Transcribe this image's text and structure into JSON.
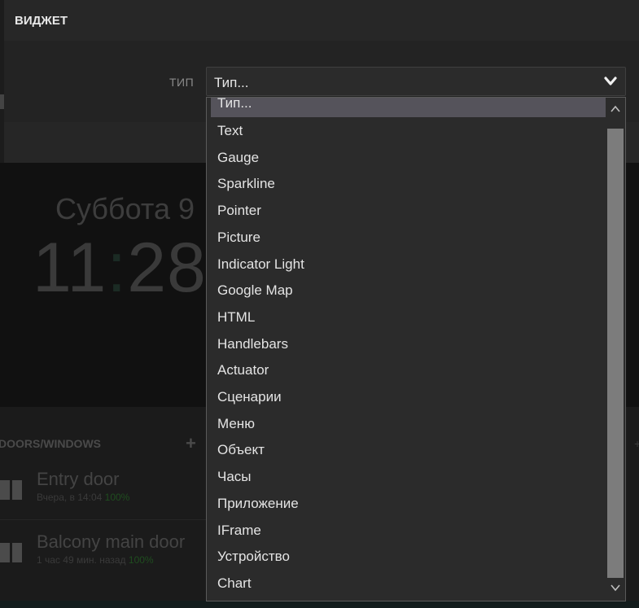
{
  "background": {
    "date": "Суббота 9",
    "time_h": "11",
    "time_colon": ":",
    "time_m": "28",
    "panel_title": "DOORS/WINDOWS",
    "add_symbol": "+",
    "right_edge_symbol": "+",
    "rows": [
      {
        "name": "Entry door",
        "meta": "Вчера, в 14:04",
        "pct": "100%"
      },
      {
        "name": "Balcony main door",
        "meta": "1 час 49 мин. назад",
        "pct": "100%"
      }
    ]
  },
  "modal": {
    "title": "ВИДЖЕТ",
    "field_label": "ТИП",
    "select_value": "Тип...",
    "options": [
      "Тип...",
      "Text",
      "Gauge",
      "Sparkline",
      "Pointer",
      "Picture",
      "Indicator Light",
      "Google Map",
      "HTML",
      "Handlebars",
      "Actuator",
      "Сценарии",
      "Меню",
      "Объект",
      "Часы",
      "Приложение",
      "IFrame",
      "Устройство",
      "Chart"
    ],
    "selected_index": 0
  },
  "icons": {
    "chevron": "chevron-down-icon",
    "scroll_up": "scroll-up-arrow-icon",
    "scroll_down": "scroll-down-arrow-icon",
    "door": "door-icon"
  }
}
